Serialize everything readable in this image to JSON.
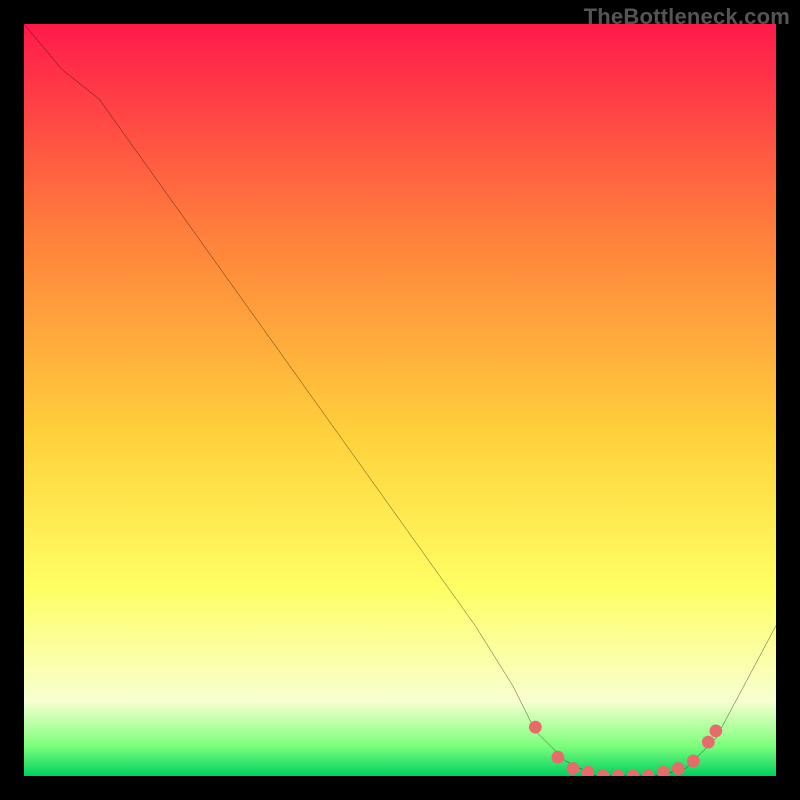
{
  "watermark": "TheBottleneck.com",
  "colors": {
    "black": "#000000",
    "line": "#000000",
    "marker": "#e86b6b",
    "grad_top": "#ff1a4b",
    "grad_mid1": "#ff803c",
    "grad_mid2": "#ffd23c",
    "grad_yellow": "#ffff64",
    "grad_pale": "#f8ffd0",
    "grad_green_light": "#7cff7c",
    "grad_green": "#00d060"
  },
  "chart_data": {
    "type": "line",
    "title": "",
    "xlabel": "",
    "ylabel": "",
    "xlim": [
      0,
      100
    ],
    "ylim": [
      0,
      100
    ],
    "series": [
      {
        "name": "curve",
        "x": [
          0,
          5,
          10,
          20,
          30,
          40,
          50,
          60,
          65,
          68,
          72,
          76,
          80,
          84,
          88,
          92,
          100
        ],
        "y": [
          100,
          94,
          90,
          76,
          62,
          48,
          34,
          20,
          12,
          6,
          2,
          0,
          0,
          0,
          1,
          5,
          20
        ]
      }
    ],
    "markers": {
      "name": "highlight",
      "x": [
        68,
        71,
        73,
        75,
        77,
        79,
        81,
        83,
        85,
        87,
        89,
        91,
        92
      ],
      "y": [
        6.5,
        2.5,
        1,
        0.5,
        0,
        0,
        0,
        0,
        0.5,
        1,
        2,
        4.5,
        6
      ]
    }
  }
}
